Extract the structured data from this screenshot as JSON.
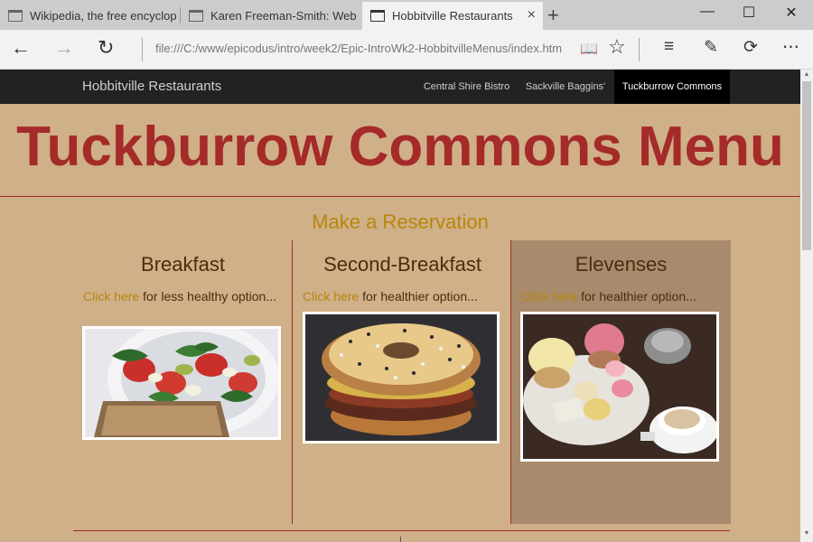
{
  "browser": {
    "tabs": [
      {
        "title": "Wikipedia, the free encyclop"
      },
      {
        "title": "Karen Freeman-Smith: Web"
      },
      {
        "title": "Hobbitville Restaurants"
      }
    ],
    "url": "file:///C:/www/epicodus/intro/week2/Epic-IntroWk2-HobbitvilleMenus/index.htm",
    "icons": {
      "close_tab": "×",
      "new_tab": "+",
      "minimize": "—",
      "maximize": "☐",
      "close_window": "✕",
      "back": "←",
      "forward": "→",
      "refresh": "↻",
      "reading_view": "📖",
      "favorite": "☆",
      "hub": "≡",
      "web_note": "✎",
      "share": "⟳",
      "more": "⋯"
    }
  },
  "navbar": {
    "brand": "Hobbitville Restaurants",
    "links": [
      "Central Shire Bistro",
      "Sackville Baggins'",
      "Tuckburrow Commons"
    ]
  },
  "page": {
    "title": "Tuckburrow Commons Menu",
    "reservation": "Make a Reservation"
  },
  "menus": [
    {
      "heading": "Breakfast",
      "link": "Click here",
      "text": " for less healthy option..."
    },
    {
      "heading": "Second-Breakfast",
      "link": "Click here",
      "text": " for healthier option..."
    },
    {
      "heading": "Elevenses",
      "link": "Click here",
      "text": " for healthier option..."
    }
  ],
  "colors": {
    "page_bg": "#cfb088",
    "title": "#a52a2a",
    "link": "#b8860b",
    "navbar": "#222222"
  }
}
